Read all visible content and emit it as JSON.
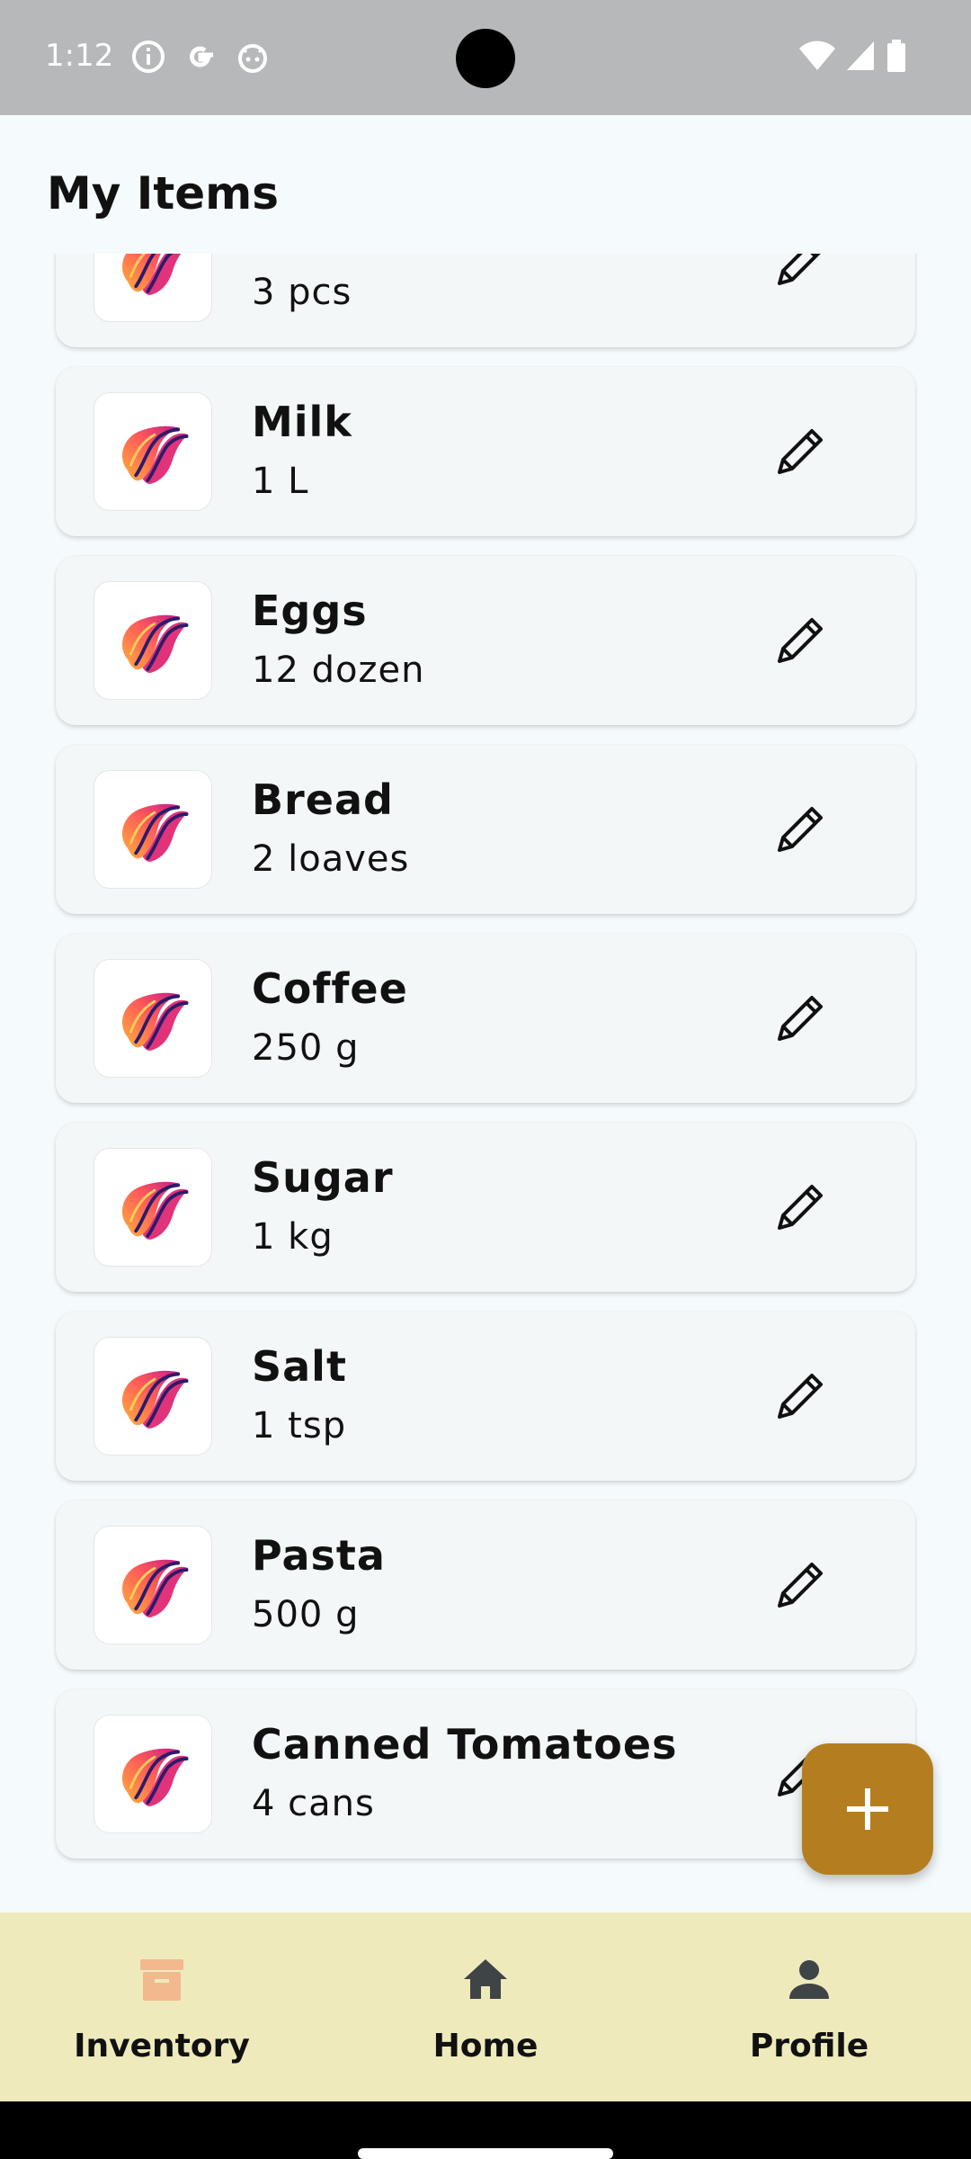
{
  "status_bar": {
    "time": "1:12",
    "left_icons": [
      "info-icon",
      "google-icon",
      "android-face-icon"
    ],
    "right_icons": [
      "wifi-icon",
      "signal-icon",
      "battery-icon"
    ]
  },
  "header": {
    "title": "My Items"
  },
  "items": [
    {
      "name": "",
      "qty": "3 pcs"
    },
    {
      "name": "Milk",
      "qty": "1 L"
    },
    {
      "name": "Eggs",
      "qty": "12 dozen"
    },
    {
      "name": "Bread",
      "qty": "2 loaves"
    },
    {
      "name": "Coffee",
      "qty": "250 g"
    },
    {
      "name": "Sugar",
      "qty": "1 kg"
    },
    {
      "name": "Salt",
      "qty": "1 tsp"
    },
    {
      "name": "Pasta",
      "qty": "500 g"
    },
    {
      "name": "Canned Tomatoes",
      "qty": "4 cans"
    }
  ],
  "fab": {
    "icon": "plus-icon"
  },
  "bottom_nav": [
    {
      "label": "Inventory",
      "icon": "inventory-box-icon"
    },
    {
      "label": "Home",
      "icon": "home-icon"
    },
    {
      "label": "Profile",
      "icon": "person-icon"
    }
  ],
  "colors": {
    "accent": "#b47e20",
    "nav_background": "#eeeabb",
    "inventory_icon": "#f3b98e",
    "status_bar": "#b6b8b9"
  }
}
